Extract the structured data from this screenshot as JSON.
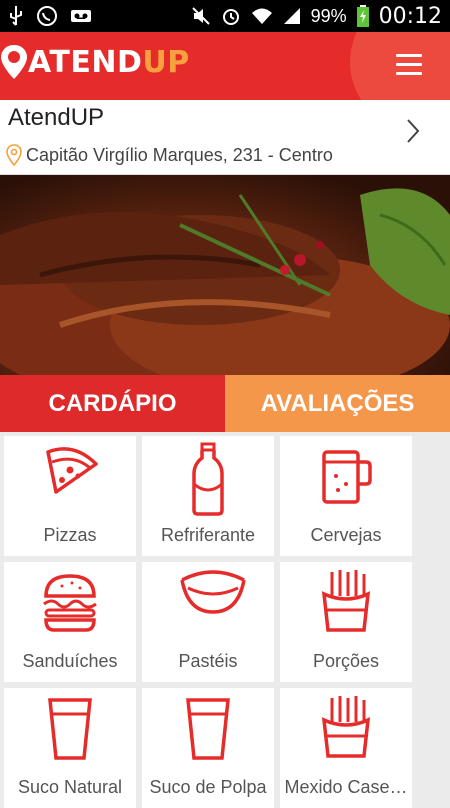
{
  "status_bar": {
    "battery": "99%",
    "time": "00:12",
    "icons": [
      "usb-icon",
      "whatsapp-icon",
      "voicemail-icon",
      "mute-icon",
      "alarm-icon",
      "wifi-icon",
      "signal-icon",
      "battery-icon"
    ]
  },
  "app_bar": {
    "logo_main": "ATEND",
    "logo_accent": "UP",
    "menu_icon": "hamburger-icon",
    "colors": {
      "bar": "#e62b2b",
      "accent": "#f6a13e"
    }
  },
  "place": {
    "name": "AtendUP",
    "address": "Capitão Virgílio Marques, 231 - Centro"
  },
  "tabs": [
    {
      "label": "CARDÁPIO",
      "active": true,
      "color": "#de2a2a"
    },
    {
      "label": "AVALIAÇÕES",
      "active": false,
      "color": "#f4974b"
    }
  ],
  "menu_categories": [
    {
      "label": "Pizzas",
      "icon": "pizza-icon"
    },
    {
      "label": "Refriferante",
      "icon": "soda-bottle-icon"
    },
    {
      "label": "Cervejas",
      "icon": "beer-mug-icon"
    },
    {
      "label": "Sanduíches",
      "icon": "burger-icon"
    },
    {
      "label": "Pastéis",
      "icon": "pastel-icon"
    },
    {
      "label": "Porções",
      "icon": "fries-icon"
    },
    {
      "label": "Suco Natural",
      "icon": "cup-icon"
    },
    {
      "label": "Suco de Polpa",
      "icon": "cup-icon"
    },
    {
      "label": "Mexido Case…",
      "icon": "fries-icon"
    }
  ]
}
